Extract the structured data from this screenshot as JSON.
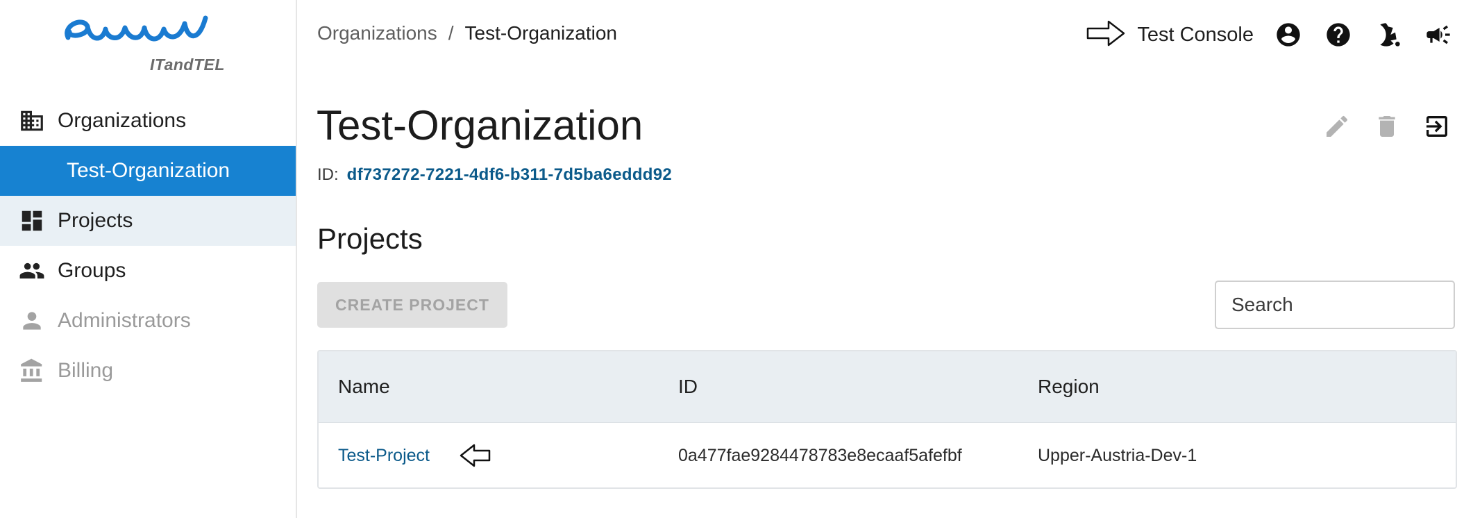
{
  "sidebar": {
    "logo_subtitle": "ITandTEL",
    "items": [
      {
        "label": "Organizations",
        "icon": "building-icon"
      },
      {
        "label": "Test-Organization"
      },
      {
        "label": "Projects",
        "icon": "dashboard-icon"
      },
      {
        "label": "Groups",
        "icon": "people-icon"
      },
      {
        "label": "Administrators",
        "icon": "person-icon"
      },
      {
        "label": "Billing",
        "icon": "bank-icon"
      }
    ]
  },
  "header": {
    "breadcrumb": [
      "Organizations",
      "/",
      "Test-Organization"
    ],
    "console_label": "Test Console",
    "icons": [
      "account-circle-icon",
      "help-icon",
      "dark-mode-icon",
      "announcement-icon"
    ]
  },
  "main": {
    "title": "Test-Organization",
    "id_label": "ID:",
    "id_value": "df737272-7221-4df6-b311-7d5ba6eddd92",
    "section_title": "Projects",
    "create_button": "CREATE PROJECT",
    "search_placeholder": "Search",
    "table": {
      "columns": [
        "Name",
        "ID",
        "Region"
      ],
      "rows": [
        {
          "name": "Test-Project",
          "id": "0a477fae9284478783e8ecaaf5afefbf",
          "region": "Upper-Austria-Dev-1"
        }
      ]
    }
  },
  "colors": {
    "accent": "#1782d1",
    "link": "#0b5a8a",
    "selected_bg": "#e9f0f5"
  }
}
